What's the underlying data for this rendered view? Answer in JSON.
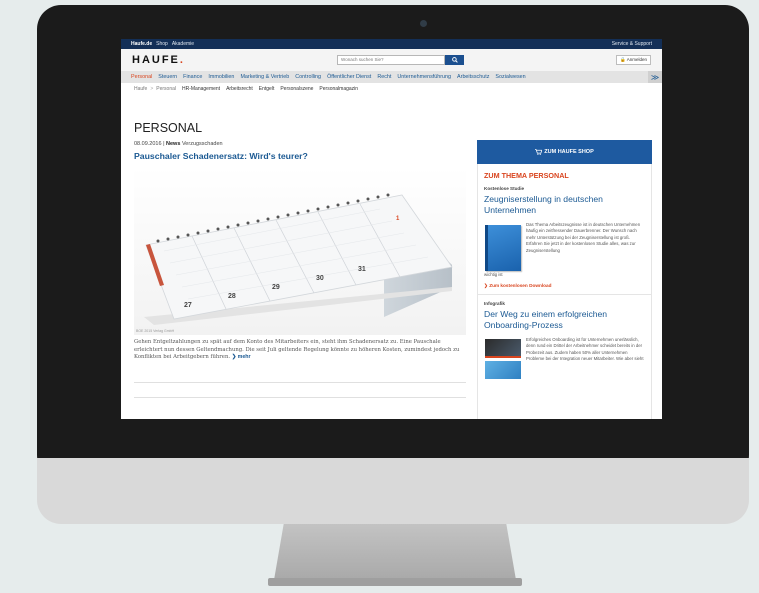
{
  "topbar": {
    "brand": "Haufe.de",
    "links": [
      "Shop",
      "Akademie"
    ],
    "right": "Service & Support"
  },
  "header": {
    "logo_text": "HAUFE",
    "logo_dot": ".",
    "search_placeholder": "Wonach suchen Sie?",
    "login_label": "Anmelden",
    "brand_color": "#d9451f"
  },
  "nav": {
    "items": [
      "Personal",
      "Steuern",
      "Finance",
      "Immobilien",
      "Marketing & Vertrieb",
      "Controlling",
      "Öffentlicher Dienst",
      "Recht",
      "Unternehmensführung",
      "Arbeitsschutz",
      "Sozialwesen"
    ],
    "more_label": "≫"
  },
  "breadcrumb": {
    "home": "Haufe",
    "sep": ">",
    "current": "Personal",
    "items": [
      "HR-Management",
      "Arbeitsrecht",
      "Entgelt",
      "Personalszene",
      "Personalmagazin"
    ]
  },
  "main": {
    "page_title": "PERSONAL",
    "date": "08.09.2016",
    "sep": "|",
    "category": "News",
    "tag": "Verzugsschaden",
    "headline": "Pauschaler Schadenersatz: Wird's teurer?",
    "image_credit": "BOE 2015 Verlag GmbH",
    "teaser": "Gehen Entgeltzahlungen zu spät auf dem Konto des Mitarbeiters ein, steht ihm Schadenersatz zu. Eine Pauschale erleichtert nun dessen Geltendmachung. Die seit Juli geltende Regelung könnte zu höheren Kosten, zumindest jedoch zu Konflikten bei Arbeitgebern führen.",
    "more_label": "mehr",
    "calendar_days": [
      "27",
      "28",
      "29",
      "30",
      "31",
      "1"
    ]
  },
  "sidebar": {
    "shop_button": "ZUM HAUFE SHOP",
    "thema": "ZUM THEMA PERSONAL",
    "study": {
      "kicker": "Kostenlose Studie",
      "title": "Zeugniserstellung in deutschen Unternehmen",
      "text": "Das Thema Arbeitszeugnisse ist in deutschen Unternehmen häufig ein zeitfressender Dauerbrenner. Der Wunsch nach mehr Unterstützung bei der Zeugniserstellung ist groß. Erfahren Sie jetzt in der kostenlosen Studie alles, was zur Zeugniserstellung",
      "tail": "wichtig ist",
      "download": "Zum kostenlosen Download"
    },
    "info": {
      "kicker": "Infografik",
      "title": "Der Weg zu einem erfolgreichen Onboarding-Prozess",
      "text": "Erfolgreiches Onboarding ist für Unternehmen unerlässlich, denn rund ein Drittel der Arbeitnehmer scheidet bereits in der Probezeit aus. Zudem haben 50% aller Unternehmen Probleme bei der Integration neuer Mitarbeiter. Wie aber sieht"
    }
  }
}
